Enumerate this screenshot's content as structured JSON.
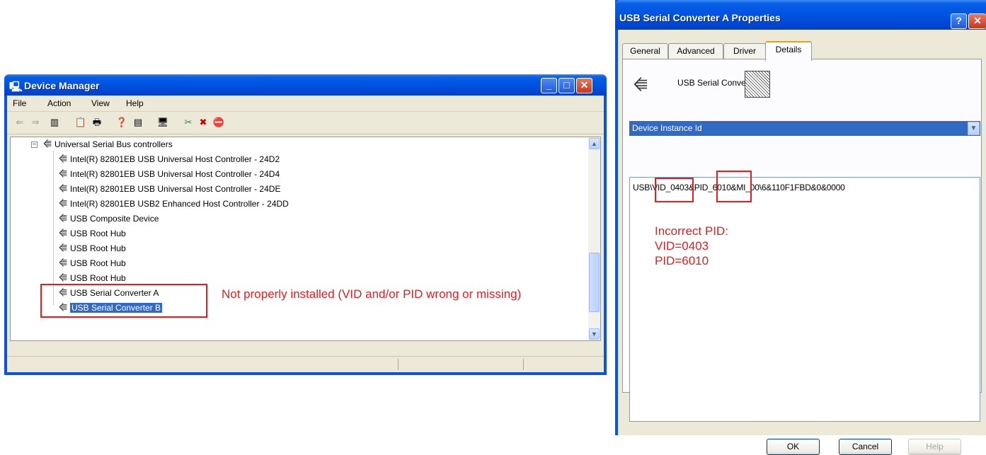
{
  "device_manager": {
    "title": "Device Manager",
    "menu": [
      "File",
      "Action",
      "View",
      "Help"
    ],
    "tree": {
      "category": "Universal Serial Bus controllers",
      "items": [
        "Intel(R) 82801EB USB Universal Host Controller - 24D2",
        "Intel(R) 82801EB USB Universal Host Controller - 24D4",
        "Intel(R) 82801EB USB Universal Host Controller - 24DE",
        "Intel(R) 82801EB USB2 Enhanced Host Controller - 24DD",
        "USB Composite Device",
        "USB Root Hub",
        "USB Root Hub",
        "USB Root Hub",
        "USB Root Hub",
        "USB Serial Converter A",
        "USB Serial Converter B"
      ],
      "selected_item": "USB Serial Converter B"
    },
    "annotation": "Not properly installed (VID and/or PID wrong or missing)"
  },
  "properties": {
    "title": "USB Serial Converter A Properties",
    "tabs": [
      "General",
      "Advanced",
      "Driver",
      "Details"
    ],
    "active_tab": "Details",
    "device_name": "USB Serial Converter",
    "property_selected": "Device Instance Id",
    "value": "USB\\VID_0403&PID_6010&MI_00\\6&110F1FBD&0&0000",
    "annotation_lines": [
      "Incorrect PID:",
      "VID=0403",
      "PID=6010"
    ],
    "buttons": {
      "ok": "OK",
      "cancel": "Cancel",
      "help": "Help"
    }
  },
  "colors": {
    "title_bar": "#0054e3",
    "selection": "#316ac5",
    "annotation_red": "#e02020",
    "dialog_bg": "#ece9d8"
  },
  "icons": [
    "computer-icon",
    "usb-icon",
    "help-icon",
    "close-icon",
    "minimize-icon",
    "maximize-icon"
  ]
}
